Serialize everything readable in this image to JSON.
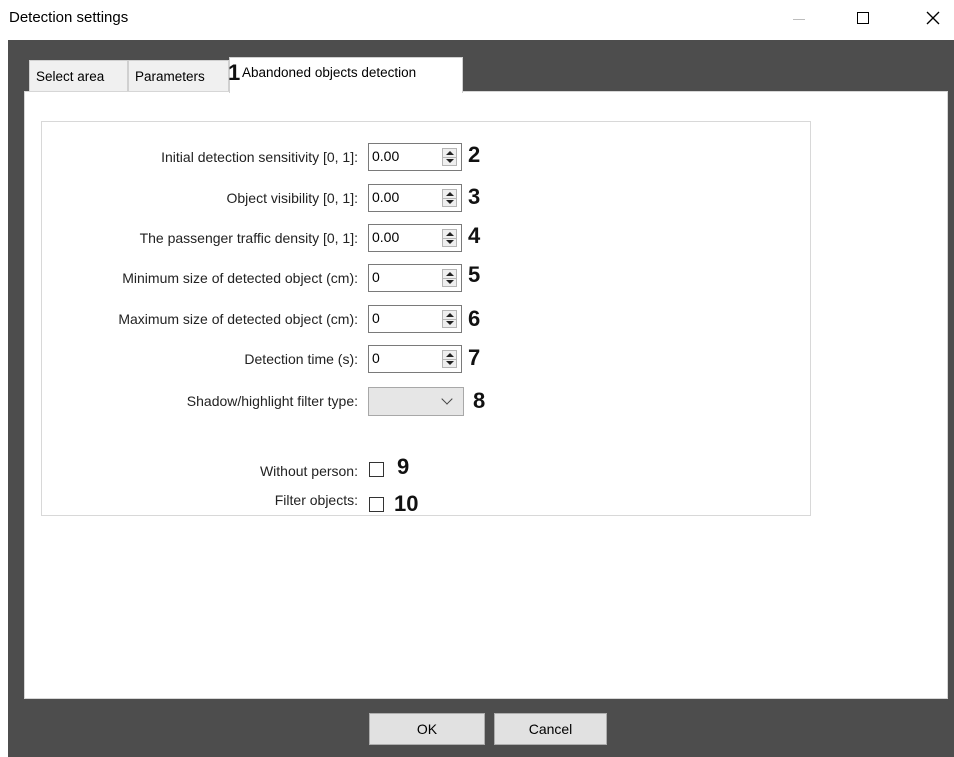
{
  "window": {
    "title": "Detection settings"
  },
  "tabs": [
    {
      "label": "Select area"
    },
    {
      "label": "Parameters"
    },
    {
      "label": "Abandoned objects detection"
    }
  ],
  "fields": [
    {
      "label": "Initial detection sensitivity [0, 1]:",
      "value": "0.00",
      "callout": "2"
    },
    {
      "label": "Object visibility [0, 1]:",
      "value": "0.00",
      "callout": "3"
    },
    {
      "label": "The passenger traffic density [0, 1]:",
      "value": "0.00",
      "callout": "4"
    },
    {
      "label": "Minimum size of detected object (cm):",
      "value": "0",
      "callout": "5"
    },
    {
      "label": "Maximum size of detected object (cm):",
      "value": "0",
      "callout": "6"
    },
    {
      "label": "Detection time (s):",
      "value": "0",
      "callout": "7"
    }
  ],
  "filter_type": {
    "label": "Shadow/highlight filter type:",
    "value": "",
    "callout": "8"
  },
  "checkboxes": [
    {
      "label": "Without person:",
      "checked": false,
      "callout": "9"
    },
    {
      "label": "Filter objects:",
      "checked": false,
      "callout": "10"
    }
  ],
  "tab_callout": "1",
  "buttons": {
    "ok": "OK",
    "cancel": "Cancel"
  }
}
